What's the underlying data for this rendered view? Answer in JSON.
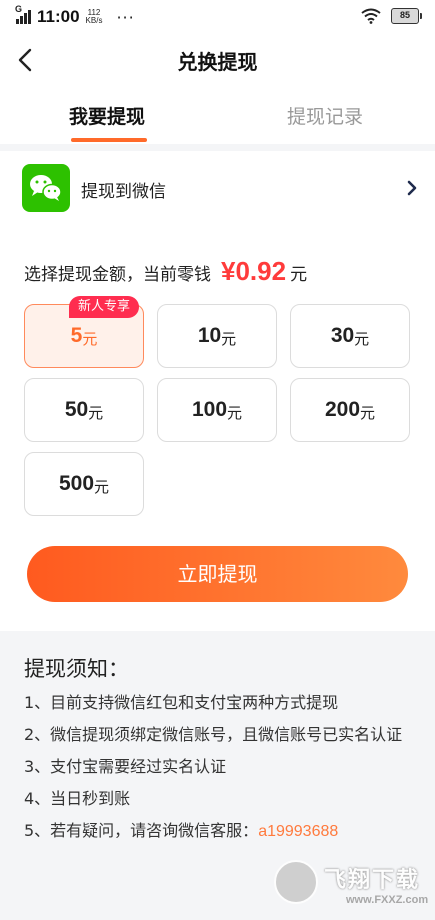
{
  "status_bar": {
    "time": "11:00",
    "signal_label": "G",
    "speed_value": "112",
    "speed_unit": "KB/s",
    "more": "···",
    "battery": "85",
    "icons": [
      "signal-icon",
      "wifi-icon",
      "battery-icon"
    ]
  },
  "nav": {
    "title": "兑换提现",
    "back_icon": "back-arrow-icon"
  },
  "tabs": [
    {
      "label": "我要提现",
      "active": true
    },
    {
      "label": "提现记录",
      "active": false
    }
  ],
  "method": {
    "label": "提现到微信",
    "icon": "wechat-icon",
    "chevron_icon": "chevron-right-icon"
  },
  "amount": {
    "label": "选择提现金额，当前零钱",
    "balance": "¥0.92",
    "balance_unit": "元"
  },
  "options": [
    {
      "value": "5",
      "unit": "元",
      "badge": "新人专享",
      "selected": true
    },
    {
      "value": "10",
      "unit": "元"
    },
    {
      "value": "30",
      "unit": "元"
    },
    {
      "value": "50",
      "unit": "元"
    },
    {
      "value": "100",
      "unit": "元"
    },
    {
      "value": "200",
      "unit": "元"
    },
    {
      "value": "500",
      "unit": "元"
    }
  ],
  "button": {
    "label": "立即提现"
  },
  "notice": {
    "title": "提现须知：",
    "items": [
      "1、目前支持微信红包和支付宝两种方式提现",
      "2、微信提现须绑定微信账号，且微信账号已实名认证",
      "3、支付宝需要经过实名认证",
      "4、当日秒到账",
      "5、若有疑问，请咨询微信客服："
    ],
    "cs_id": "a19993688"
  },
  "watermark": {
    "text": "飞翔下载",
    "url": "www.FXXZ.com"
  },
  "colors": {
    "accent": "#ff6a2a",
    "balance": "#ff3b3b",
    "wechat": "#2dc100",
    "badge": "#ff2d4f"
  }
}
